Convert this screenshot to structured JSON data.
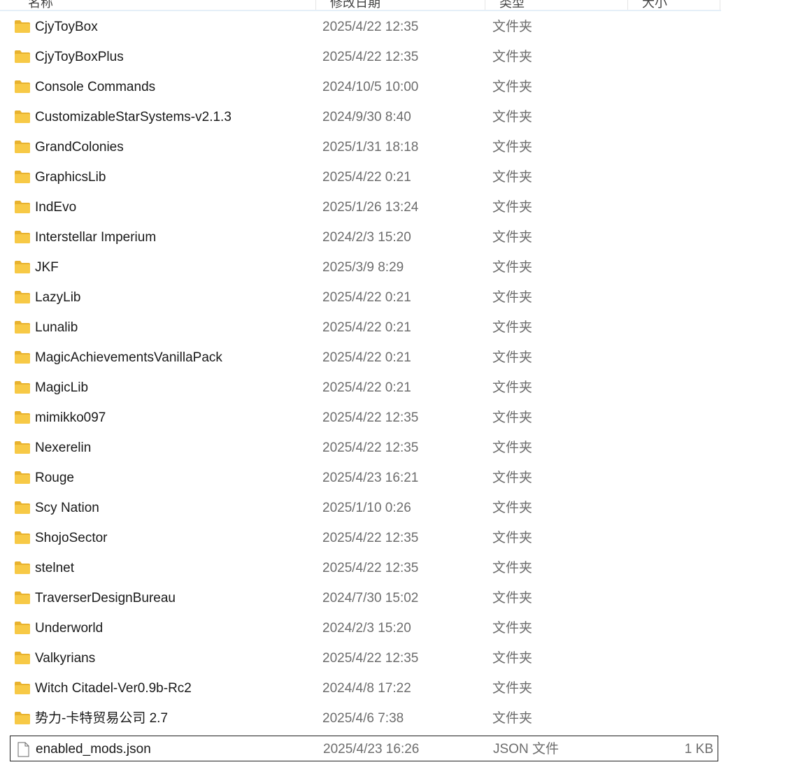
{
  "columns": {
    "name": "名称",
    "date": "修改日期",
    "type": "类型",
    "size": "大小"
  },
  "colors": {
    "folder": "#f7c946",
    "folder_tab": "#e8b22e",
    "header_line": "#e5eff8",
    "secondary_text": "#6d6d6d",
    "selection_border": "#202020"
  },
  "files": [
    {
      "name": "CjyToyBox",
      "date": "2025/4/22 12:35",
      "type": "文件夹",
      "size": "",
      "icon": "folder-icon"
    },
    {
      "name": "CjyToyBoxPlus",
      "date": "2025/4/22 12:35",
      "type": "文件夹",
      "size": "",
      "icon": "folder-icon"
    },
    {
      "name": "Console Commands",
      "date": "2024/10/5 10:00",
      "type": "文件夹",
      "size": "",
      "icon": "folder-icon"
    },
    {
      "name": "CustomizableStarSystems-v2.1.3",
      "date": "2024/9/30 8:40",
      "type": "文件夹",
      "size": "",
      "icon": "folder-icon"
    },
    {
      "name": "GrandColonies",
      "date": "2025/1/31 18:18",
      "type": "文件夹",
      "size": "",
      "icon": "folder-icon"
    },
    {
      "name": "GraphicsLib",
      "date": "2025/4/22 0:21",
      "type": "文件夹",
      "size": "",
      "icon": "folder-icon"
    },
    {
      "name": "IndEvo",
      "date": "2025/1/26 13:24",
      "type": "文件夹",
      "size": "",
      "icon": "folder-icon"
    },
    {
      "name": "Interstellar Imperium",
      "date": "2024/2/3 15:20",
      "type": "文件夹",
      "size": "",
      "icon": "folder-icon"
    },
    {
      "name": "JKF",
      "date": "2025/3/9 8:29",
      "type": "文件夹",
      "size": "",
      "icon": "folder-icon"
    },
    {
      "name": "LazyLib",
      "date": "2025/4/22 0:21",
      "type": "文件夹",
      "size": "",
      "icon": "folder-icon"
    },
    {
      "name": "Lunalib",
      "date": "2025/4/22 0:21",
      "type": "文件夹",
      "size": "",
      "icon": "folder-icon"
    },
    {
      "name": "MagicAchievementsVanillaPack",
      "date": "2025/4/22 0:21",
      "type": "文件夹",
      "size": "",
      "icon": "folder-icon"
    },
    {
      "name": "MagicLib",
      "date": "2025/4/22 0:21",
      "type": "文件夹",
      "size": "",
      "icon": "folder-icon"
    },
    {
      "name": "mimikko097",
      "date": "2025/4/22 12:35",
      "type": "文件夹",
      "size": "",
      "icon": "folder-icon"
    },
    {
      "name": "Nexerelin",
      "date": "2025/4/22 12:35",
      "type": "文件夹",
      "size": "",
      "icon": "folder-icon"
    },
    {
      "name": "Rouge",
      "date": "2025/4/23 16:21",
      "type": "文件夹",
      "size": "",
      "icon": "folder-icon"
    },
    {
      "name": "Scy Nation",
      "date": "2025/1/10 0:26",
      "type": "文件夹",
      "size": "",
      "icon": "folder-icon"
    },
    {
      "name": "ShojoSector",
      "date": "2025/4/22 12:35",
      "type": "文件夹",
      "size": "",
      "icon": "folder-icon"
    },
    {
      "name": "stelnet",
      "date": "2025/4/22 12:35",
      "type": "文件夹",
      "size": "",
      "icon": "folder-icon"
    },
    {
      "name": "TraverserDesignBureau",
      "date": "2024/7/30 15:02",
      "type": "文件夹",
      "size": "",
      "icon": "folder-icon"
    },
    {
      "name": "Underworld",
      "date": "2024/2/3 15:20",
      "type": "文件夹",
      "size": "",
      "icon": "folder-icon"
    },
    {
      "name": "Valkyrians",
      "date": "2025/4/22 12:35",
      "type": "文件夹",
      "size": "",
      "icon": "folder-icon"
    },
    {
      "name": "Witch Citadel-Ver0.9b-Rc2",
      "date": "2024/4/8 17:22",
      "type": "文件夹",
      "size": "",
      "icon": "folder-icon"
    },
    {
      "name": "势力-卡特贸易公司 2.7",
      "date": "2025/4/6 7:38",
      "type": "文件夹",
      "size": "",
      "icon": "folder-icon"
    },
    {
      "name": "enabled_mods.json",
      "date": "2025/4/23 16:26",
      "type": "JSON 文件",
      "size": "1 KB",
      "icon": "file-icon",
      "selected": true
    }
  ]
}
